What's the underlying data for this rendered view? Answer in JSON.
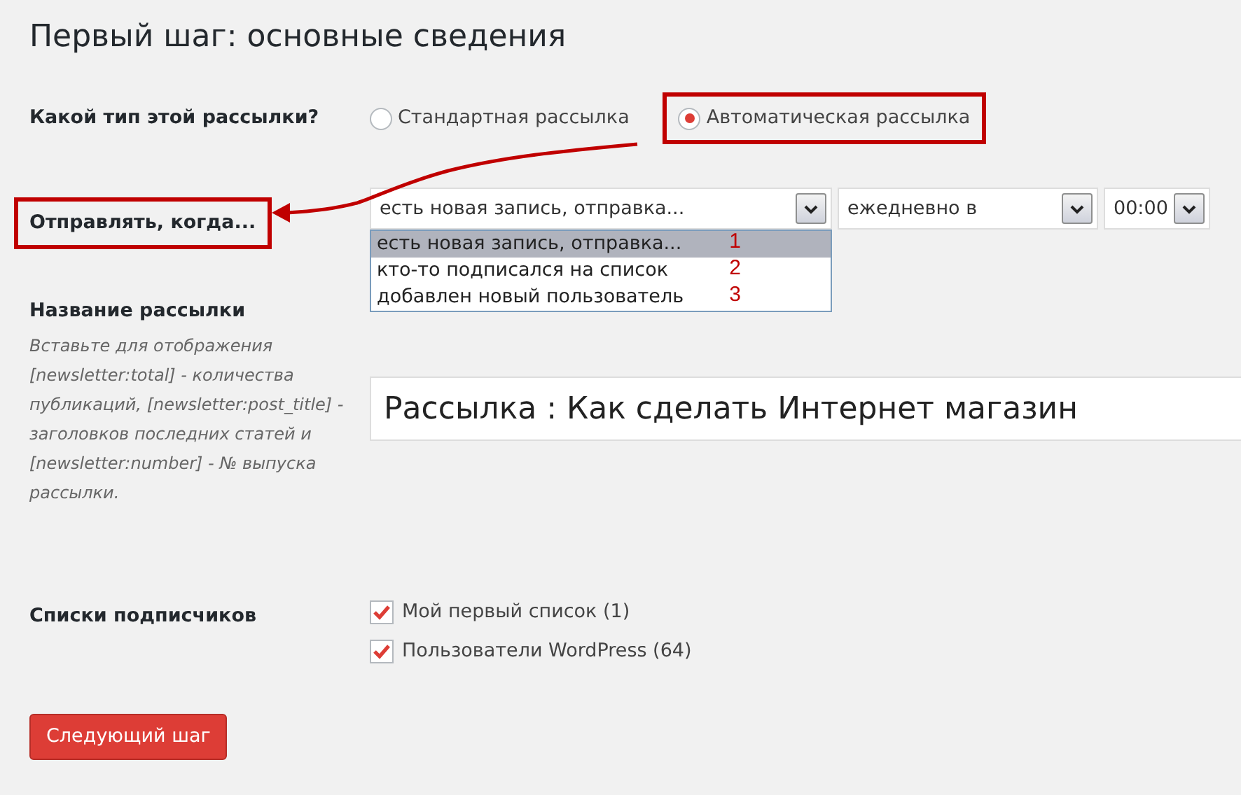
{
  "title": "Первый шаг: основные сведения",
  "type_field": {
    "label": "Какой тип этой рассылки?",
    "options": [
      {
        "label": "Стандартная рассылка",
        "selected": false,
        "highlighted": false
      },
      {
        "label": "Автоматическая рассылка",
        "selected": true,
        "highlighted": true
      }
    ]
  },
  "send_when": {
    "label": "Отправлять, когда...",
    "highlighted": true,
    "event_select": {
      "value": "есть новая запись, отправка...",
      "expanded": true,
      "options": [
        {
          "label": "есть новая запись, отправка...",
          "selected": true,
          "annotation": "1"
        },
        {
          "label": "кто-то подписался на список",
          "selected": false,
          "annotation": "2"
        },
        {
          "label": "добавлен новый пользователь",
          "selected": false,
          "annotation": "3"
        }
      ]
    },
    "frequency_select": {
      "value": "ежедневно в"
    },
    "time_select": {
      "value": "00:00"
    }
  },
  "name_field": {
    "label": "Название рассылки",
    "hint": "Вставьте для отображения [newsletter:total] - количества публикаций, [newsletter:post_title] - заголовков последних статей и [newsletter:number] - № выпуска рассылки.",
    "value": "Рассылка : Как сделать Интернет магазин"
  },
  "lists": {
    "label": "Списки подписчиков",
    "items": [
      {
        "label": "Мой первый список (1)",
        "checked": true
      },
      {
        "label": "Пользователи WordPress (64)",
        "checked": true
      }
    ]
  },
  "next_button": "Следующий шаг"
}
